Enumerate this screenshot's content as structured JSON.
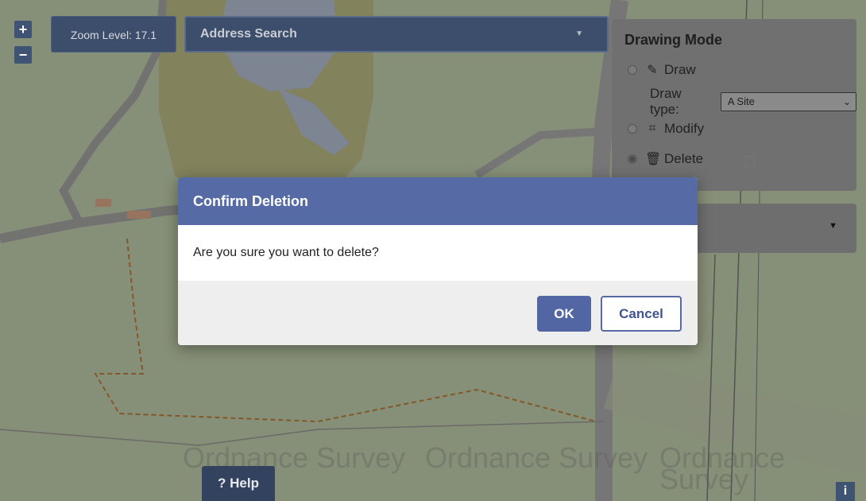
{
  "map": {
    "zoom_in_label": "+",
    "zoom_out_label": "−",
    "zoom_level_text": "Zoom Level: 17.1",
    "watermark_text": "Ordnance Survey",
    "help_label": "Help",
    "help_icon": "?",
    "info_label": "i"
  },
  "search": {
    "placeholder": "Address Search",
    "caret_icon": "chevron-down-icon"
  },
  "drawing_panel": {
    "title": "Drawing Mode",
    "options": [
      {
        "label": "Draw",
        "icon": "magic-wand-icon",
        "selected": false
      },
      {
        "label": "Modify",
        "icon": "modify-icon",
        "selected": false
      },
      {
        "label": "Delete",
        "icon": "trash-icon",
        "selected": true
      }
    ],
    "draw_type_label": "Draw type:",
    "draw_type_value": "A Site"
  },
  "dialog": {
    "title": "Confirm Deletion",
    "message": "Are you sure you want to delete?",
    "ok_label": "OK",
    "cancel_label": "Cancel"
  },
  "colors": {
    "dialog_header": "#566ba6",
    "primary_button": "#5166a3",
    "control_bg": "#3d4d6c"
  }
}
